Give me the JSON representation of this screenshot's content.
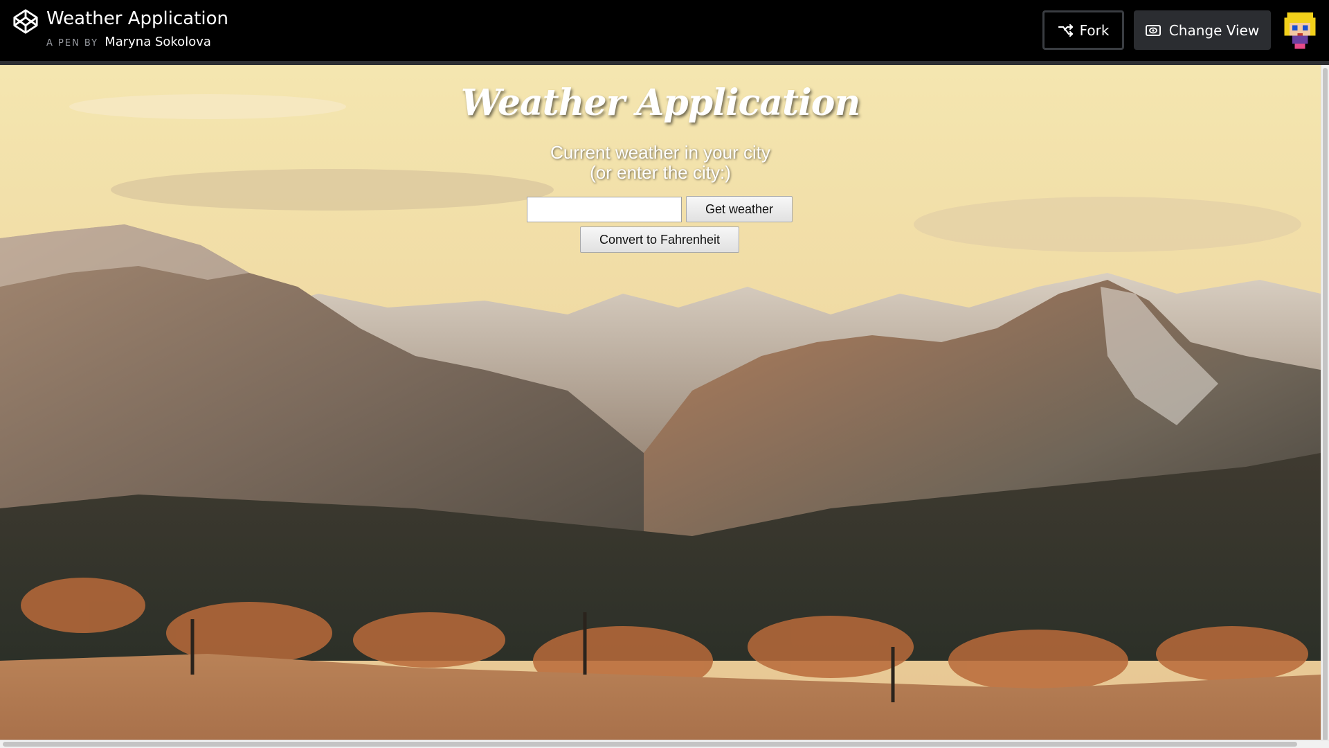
{
  "codepen": {
    "pen_title": "Weather Application",
    "byline_prefix": "A PEN BY",
    "author": "Maryna Sokolova",
    "fork_label": "Fork",
    "change_view_label": "Change View",
    "icons": {
      "logo": "codepen-logo-icon",
      "fork": "fork-icon",
      "change_view": "eye-icon",
      "avatar": "user-avatar"
    }
  },
  "app": {
    "title": "Weather Application",
    "subtitle_line1": "Current weather in your city",
    "subtitle_line2": "(or enter the city:)",
    "city_input_value": "",
    "get_weather_label": "Get weather",
    "convert_label": "Convert to Fahrenheit"
  },
  "colors": {
    "topbar_bg": "#000000",
    "change_view_bg": "#2b2d31",
    "sky": "#f3dfa0",
    "foreground": "#b87a4e"
  }
}
